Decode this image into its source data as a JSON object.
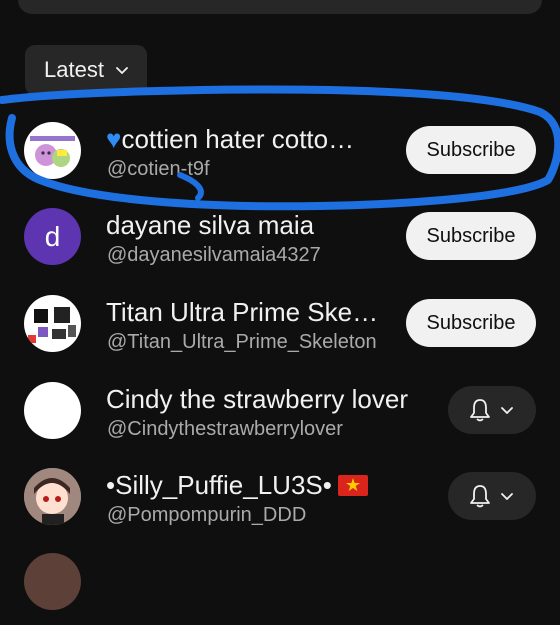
{
  "filter": {
    "label": "Latest"
  },
  "channels": [
    {
      "name": "cottien hater cotto…",
      "name_prefix_icon": "blue-heart-icon",
      "handle": "@cotien-t9f",
      "action": "Subscribe",
      "avatar_kind": "image",
      "avatar_bg": "#ffffff"
    },
    {
      "name": "dayane silva maia",
      "handle": "@dayanesilvamaia4327",
      "action": "Subscribe",
      "avatar_kind": "letter",
      "avatar_letter": "d",
      "avatar_bg": "#5e35b1"
    },
    {
      "name": "Titan Ultra Prime Ske…",
      "handle": "@Titan_Ultra_Prime_Skeleton",
      "action": "Subscribe",
      "avatar_kind": "image",
      "avatar_bg": "#ffffff"
    },
    {
      "name": "Cindy the strawberry lover",
      "handle": "@Cindythestrawberrylover",
      "action": "bell",
      "avatar_kind": "blank",
      "avatar_bg": "#ffffff"
    },
    {
      "name": "•Silly_Puffie_LU3S•",
      "name_suffix_icon": "vietnam-flag-icon",
      "handle": "@Pompompurin_DDD",
      "action": "bell",
      "avatar_kind": "image",
      "avatar_bg": "#8d6e63"
    }
  ],
  "colors": {
    "background": "#0f0f0f",
    "chip": "#272727",
    "subscribe_bg": "#f1f1f1",
    "annotation": "#1e6fe0"
  },
  "icons": {
    "chip": "chevron-down-icon",
    "bell": "bell-icon",
    "bell_menu": "chevron-down-icon"
  }
}
